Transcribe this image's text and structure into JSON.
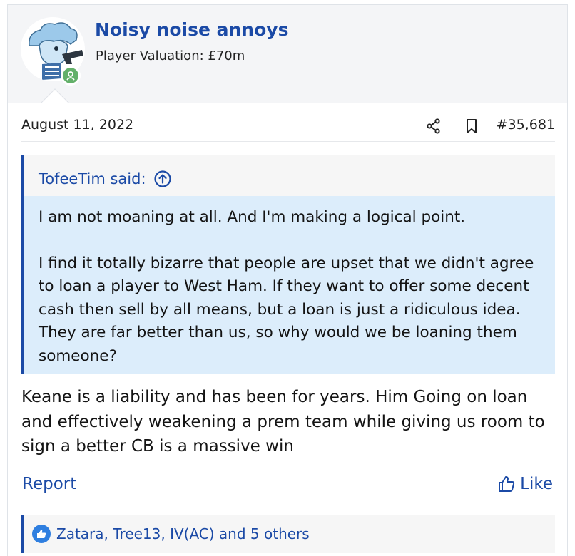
{
  "user": {
    "username": "Noisy noise annoys",
    "title": "Player Valuation: £70m"
  },
  "post": {
    "date": "August 11, 2022",
    "number": "#35,681"
  },
  "quote": {
    "author_text": "TofeeTim said:",
    "paragraphs": [
      "I am not moaning at all. And I'm making a logical point.",
      "I find it totally bizarre that people are upset that we didn't agree to loan a player to West Ham. If they want to offer some decent cash then sell by all means, but a loan is just a ridiculous idea. They are far better than us, so why would we be loaning them someone?"
    ]
  },
  "message": "Keane is a liability and has been for years. Him Going on loan and effectively weakening a prem team while giving us room to sign a better CB is a massive win",
  "actions": {
    "report": "Report",
    "like": "Like"
  },
  "reactions": {
    "text": "Zatara, Tree13, IV(AC) and 5 others"
  },
  "colors": {
    "link": "#1b4aa6",
    "quote_bg": "#dcedfb",
    "online": "#63b06a"
  },
  "icons": [
    "share-icon",
    "bookmark-icon",
    "jump-to-quote-icon",
    "thumbs-up-icon",
    "like-reaction-icon"
  ]
}
